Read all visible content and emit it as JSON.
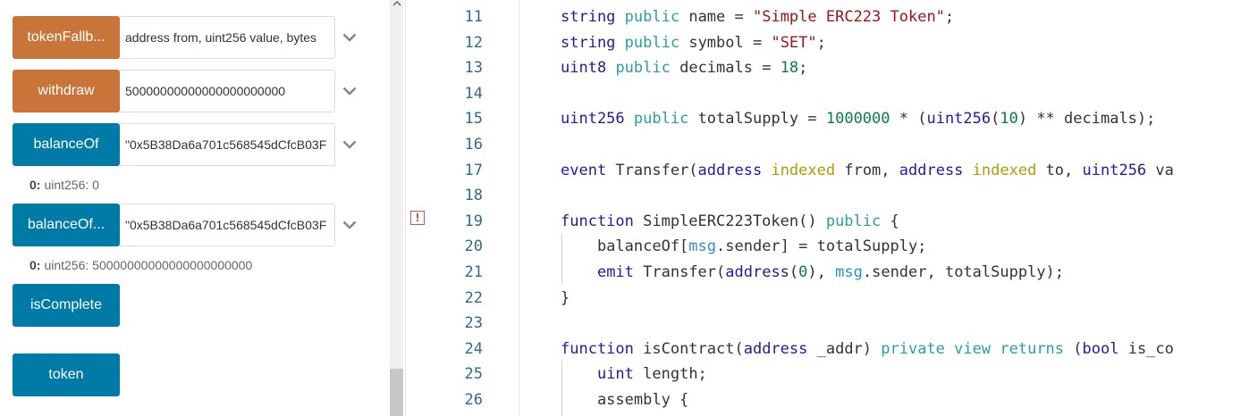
{
  "functions": [
    {
      "label": "tokenFallb...",
      "value": "address from, uint256 value, bytes",
      "color": "#c97539"
    },
    {
      "label": "withdraw",
      "value": "50000000000000000000000",
      "color": "#c97539"
    },
    {
      "label": "balanceOf",
      "value": "\"0x5B38Da6a701c568545dCfcB03F",
      "color": "#007aa6",
      "result": {
        "index": "0:",
        "text": "uint256: 0"
      }
    },
    {
      "label": "balanceOf...",
      "value": "\"0x5B38Da6a701c568545dCfcB03F",
      "color": "#007aa6",
      "result": {
        "index": "0:",
        "text": "uint256: 50000000000000000000000"
      }
    },
    {
      "label": "isComplete",
      "color": "#007aa6"
    },
    {
      "label": "token",
      "color": "#007aa6"
    }
  ],
  "editor": {
    "warning_glyph": "!",
    "lines": [
      {
        "n": "11",
        "tokens": [
          [
            "string",
            "blue"
          ],
          [
            " ",
            "dark"
          ],
          [
            "public",
            "green"
          ],
          [
            " name = ",
            "dark"
          ],
          [
            "\"Simple ERC223 Token\"",
            "str"
          ],
          [
            ";",
            "dark"
          ]
        ]
      },
      {
        "n": "12",
        "tokens": [
          [
            "string",
            "blue"
          ],
          [
            " ",
            "dark"
          ],
          [
            "public",
            "green"
          ],
          [
            " symbol = ",
            "dark"
          ],
          [
            "\"SET\"",
            "str"
          ],
          [
            ";",
            "dark"
          ]
        ]
      },
      {
        "n": "13",
        "tokens": [
          [
            "uint8",
            "blue"
          ],
          [
            " ",
            "dark"
          ],
          [
            "public",
            "green"
          ],
          [
            " decimals = ",
            "dark"
          ],
          [
            "18",
            "num"
          ],
          [
            ";",
            "dark"
          ]
        ]
      },
      {
        "n": "14",
        "tokens": []
      },
      {
        "n": "15",
        "tokens": [
          [
            "uint256",
            "blue"
          ],
          [
            " ",
            "dark"
          ],
          [
            "public",
            "green"
          ],
          [
            " totalSupply = ",
            "dark"
          ],
          [
            "1000000",
            "num"
          ],
          [
            " * (",
            "dark"
          ],
          [
            "uint256",
            "blue"
          ],
          [
            "(",
            "dark"
          ],
          [
            "10",
            "num"
          ],
          [
            ") ** decimals);",
            "dark"
          ]
        ]
      },
      {
        "n": "16",
        "tokens": []
      },
      {
        "n": "17",
        "tokens": [
          [
            "event",
            "blue"
          ],
          [
            " Transfer(",
            "dark"
          ],
          [
            "address",
            "blue"
          ],
          [
            " ",
            "dark"
          ],
          [
            "indexed",
            "yellow"
          ],
          [
            " from, ",
            "dark"
          ],
          [
            "address",
            "blue"
          ],
          [
            " ",
            "dark"
          ],
          [
            "indexed",
            "yellow"
          ],
          [
            " to, ",
            "dark"
          ],
          [
            "uint256",
            "blue"
          ],
          [
            " va",
            "dark"
          ]
        ]
      },
      {
        "n": "18",
        "tokens": []
      },
      {
        "n": "19",
        "tokens": [
          [
            "function",
            "blue"
          ],
          [
            " SimpleERC223Token() ",
            "dark"
          ],
          [
            "public",
            "green"
          ],
          [
            " {",
            "dark"
          ]
        ]
      },
      {
        "n": "20",
        "tokens": [
          [
            "    balanceOf[",
            "dark"
          ],
          [
            "msg",
            "light"
          ],
          [
            ".sender] = totalSupply;",
            "dark"
          ]
        ]
      },
      {
        "n": "21",
        "tokens": [
          [
            "    ",
            "dark"
          ],
          [
            "emit",
            "blue"
          ],
          [
            " Transfer(",
            "dark"
          ],
          [
            "address",
            "blue"
          ],
          [
            "(",
            "dark"
          ],
          [
            "0",
            "num"
          ],
          [
            "), ",
            "dark"
          ],
          [
            "msg",
            "light"
          ],
          [
            ".sender, totalSupply);",
            "dark"
          ]
        ]
      },
      {
        "n": "22",
        "tokens": [
          [
            "}",
            "dark"
          ]
        ]
      },
      {
        "n": "23",
        "tokens": []
      },
      {
        "n": "24",
        "tokens": [
          [
            "function",
            "blue"
          ],
          [
            " isContract(",
            "dark"
          ],
          [
            "address",
            "blue"
          ],
          [
            " _addr) ",
            "dark"
          ],
          [
            "private",
            "green"
          ],
          [
            " ",
            "dark"
          ],
          [
            "view",
            "green"
          ],
          [
            " ",
            "dark"
          ],
          [
            "returns",
            "green"
          ],
          [
            " (",
            "dark"
          ],
          [
            "bool",
            "blue"
          ],
          [
            " is_co",
            "dark"
          ]
        ]
      },
      {
        "n": "25",
        "tokens": [
          [
            "    ",
            "dark"
          ],
          [
            "uint",
            "blue"
          ],
          [
            " length;",
            "dark"
          ]
        ]
      },
      {
        "n": "26",
        "tokens": [
          [
            "    assembly {",
            "dark"
          ]
        ]
      }
    ]
  }
}
